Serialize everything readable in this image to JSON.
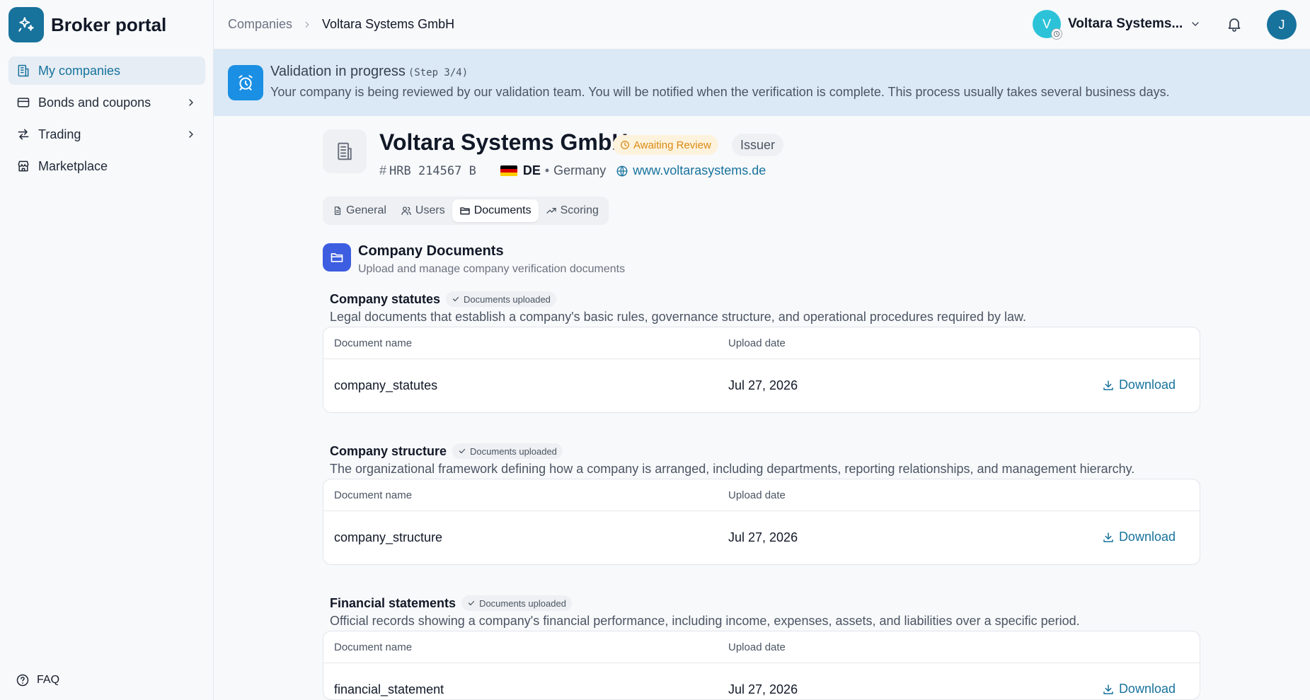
{
  "brand": {
    "name": "Broker portal",
    "logo_icon": "sparkles-icon",
    "color": "#17729c"
  },
  "sidebar": {
    "items": [
      {
        "label": "My companies",
        "icon": "building-icon",
        "active": true
      },
      {
        "label": "Bonds and coupons",
        "icon": "card-icon",
        "chevron": true
      },
      {
        "label": "Trading",
        "icon": "arrows-icon",
        "chevron": true
      },
      {
        "label": "Marketplace",
        "icon": "store-icon"
      }
    ],
    "faq": "FAQ"
  },
  "topbar": {
    "breadcrumb": [
      "Companies",
      "Voltara Systems GmbH"
    ],
    "company_switch": {
      "initial": "V",
      "name": "Voltara Systems..."
    },
    "user_initial": "J"
  },
  "banner": {
    "title": "Validation in progress",
    "step": "(Step 3/4)",
    "text": "Your company is being reviewed by our validation team. You will be notified when the verification is complete. This process usually takes several business days."
  },
  "company": {
    "name": "Voltara Systems GmbH",
    "status_badge": "Awaiting Review",
    "role_badge": "Issuer",
    "hash": "#",
    "registry": "HRB 214567 B",
    "country_code": "DE",
    "separator": "•",
    "country": "Germany",
    "website": "www.voltarasystems.de"
  },
  "tabs": [
    {
      "label": "General",
      "icon": "file-icon"
    },
    {
      "label": "Users",
      "icon": "users-icon"
    },
    {
      "label": "Documents",
      "icon": "folder-icon",
      "active": true
    },
    {
      "label": "Scoring",
      "icon": "trending-icon"
    }
  ],
  "documents": {
    "title": "Company Documents",
    "subtitle": "Upload and manage company verification documents",
    "col_name": "Document name",
    "col_date": "Upload date",
    "download_label": "Download",
    "sections": [
      {
        "title": "Company statutes",
        "badge": "Documents uploaded",
        "description": "Legal documents that establish a company's basic rules, governance structure, and operational procedures required by law.",
        "file": "company_statutes",
        "date": "Jul 27, 2026"
      },
      {
        "title": "Company structure",
        "badge": "Documents uploaded",
        "description": "The organizational framework defining how a company is arranged, including departments, reporting relationships, and management hierarchy.",
        "file": "company_structure",
        "date": "Jul 27, 2026"
      },
      {
        "title": "Financial statements",
        "badge": "Documents uploaded",
        "description": "Official records showing a company's financial performance, including income, expenses, assets, and liabilities over a specific period.",
        "file": "financial_statement",
        "date": "Jul 27, 2026"
      }
    ]
  }
}
